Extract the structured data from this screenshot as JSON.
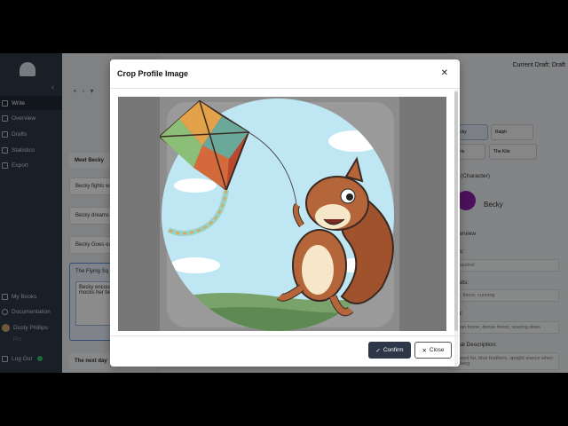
{
  "app": {
    "current_draft": "Current Draft: Draft"
  },
  "sidebar": {
    "items": [
      {
        "label": "Write",
        "icon": "pencil-icon"
      },
      {
        "label": "Overview",
        "icon": "overview-icon"
      },
      {
        "label": "Drafts",
        "icon": "drafts-icon"
      },
      {
        "label": "Statistics",
        "icon": "chart-icon"
      },
      {
        "label": "Export",
        "icon": "export-icon"
      }
    ],
    "bottom": [
      {
        "label": "My Books",
        "icon": "book-icon"
      },
      {
        "label": "Documentation",
        "icon": "info-icon"
      },
      {
        "label": "Dusty Phillips",
        "icon": "avatar-icon"
      },
      {
        "label": "Log Out",
        "icon": "logout-icon"
      }
    ],
    "pro_label": "Pro"
  },
  "scenes": {
    "items": [
      "Meet Becky",
      "Becky fights wi",
      "Becky dreams o",
      "Becky Goes ou"
    ],
    "selected_title": "The Flying Sq",
    "selected_body": "Becky encoun squirrel name mocks her bec fly.",
    "next": "The next day"
  },
  "characters": {
    "chips": [
      "Becky",
      "Ralph",
      "Boris",
      "The Kite"
    ],
    "section_character": "(Character)",
    "name": "Becky",
    "overview": "verview",
    "species_label": "es:",
    "species_value": "d Squirrel",
    "traits_label": "raits:",
    "traits_value": "rful, fierce, cunning",
    "habitat_label": "at:",
    "habitat_value": "urban home, dense forest, soaring skies",
    "physical_label": "ical Description:",
    "physical_value": "Striped fur, blue feathers, upright stance when walking"
  },
  "modal": {
    "title": "Crop Profile Image",
    "confirm_label": "Confirm",
    "close_label": "Close"
  },
  "colors": {
    "accent": "#2d3748",
    "sidebar": "#2f3a48",
    "sky": "#bfe6f3"
  }
}
